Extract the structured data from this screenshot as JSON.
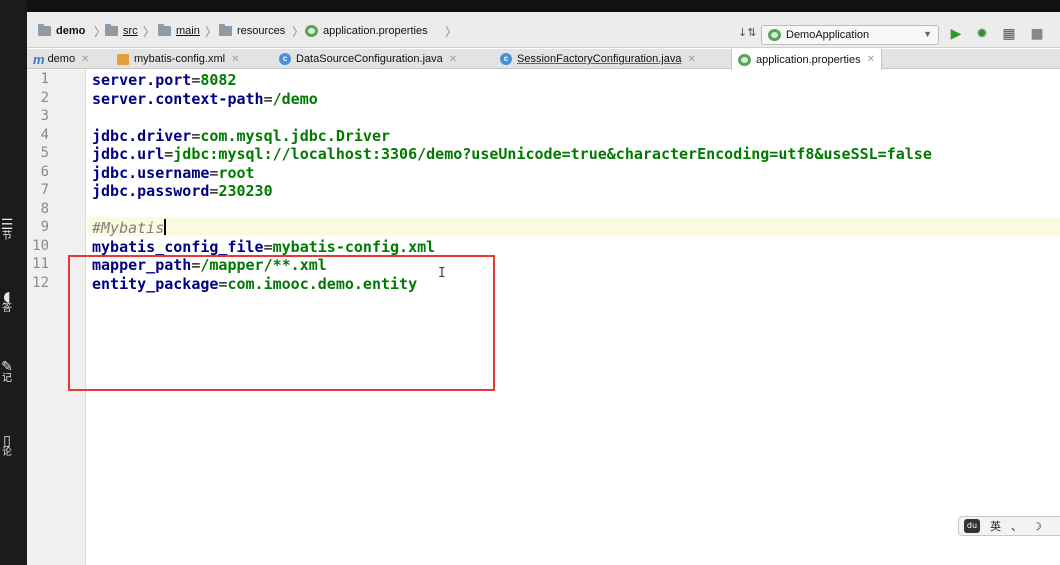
{
  "sidebar": {
    "items": [
      {
        "icon": "list-icon",
        "label": "节"
      },
      {
        "icon": "headset-icon",
        "label": "答"
      },
      {
        "icon": "pencil-icon",
        "label": "记"
      },
      {
        "icon": "chat-icon",
        "label": "论"
      }
    ]
  },
  "breadcrumb": {
    "project": "demo",
    "src": "src",
    "main": "main",
    "resources": "resources",
    "file": "application.properties"
  },
  "toolbar": {
    "run_config": "DemoApplication"
  },
  "tabs": [
    {
      "label": "demo",
      "icon": "module-icon"
    },
    {
      "label": "mybatis-config.xml",
      "icon": "xml-file-icon"
    },
    {
      "label": "DataSourceConfiguration.java",
      "icon": "class-icon"
    },
    {
      "label": "SessionFactoryConfiguration.java",
      "icon": "class-icon"
    },
    {
      "label": "application.properties",
      "icon": "properties-file-icon",
      "active": true
    }
  ],
  "editor": {
    "line_numbers": [
      "1",
      "2",
      "3",
      "4",
      "5",
      "6",
      "7",
      "8",
      "9",
      "10",
      "11",
      "12"
    ],
    "lines": [
      {
        "key": "server.port",
        "value": "8082"
      },
      {
        "key": "server.context-path",
        "value": "/demo"
      },
      {},
      {
        "key": "jdbc.driver",
        "value": "com.mysql.jdbc.Driver"
      },
      {
        "key": "jdbc.url",
        "value": "jdbc:mysql://localhost:3306/demo?useUnicode=true&characterEncoding=utf8&useSSL=false"
      },
      {
        "key": "jdbc.username",
        "value": "root"
      },
      {
        "key": "jdbc.password",
        "value": "230230"
      },
      {},
      {
        "comment": "#Mybatis"
      },
      {
        "key": "mybatis_config_file",
        "value": "mybatis-config.xml"
      },
      {
        "key": "mapper_path",
        "value": "/mapper/**.xml"
      },
      {
        "key": "entity_package",
        "value": "com.imooc.demo.entity"
      }
    ]
  },
  "ime": {
    "lang": "英",
    "punct": "、",
    "moon": "☽"
  },
  "colors": {
    "highlight_box": "#e53935",
    "key": "#000080",
    "value": "#007a00",
    "comment": "#808080"
  }
}
